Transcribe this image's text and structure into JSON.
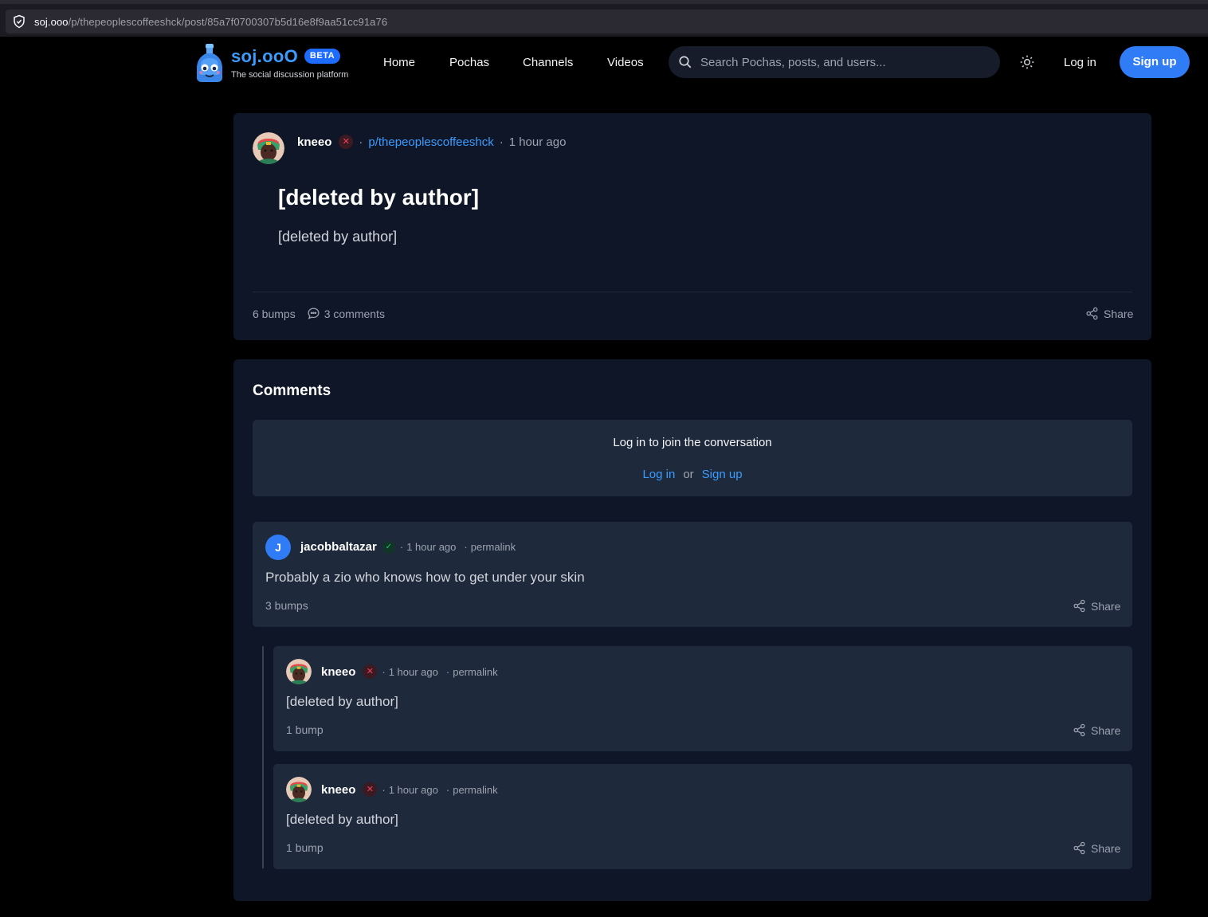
{
  "browser": {
    "url_host": "soj.ooo",
    "url_path": "/p/thepeoplescoffeeshck/post/85a7f0700307b5d16e8f9aa51cc91a76"
  },
  "header": {
    "brand": "soj.ooO",
    "beta": "BETA",
    "tagline": "The social discussion platform",
    "nav": [
      "Home",
      "Pochas",
      "Channels",
      "Videos"
    ],
    "search_placeholder": "Search Pochas, posts, and users...",
    "login": "Log in",
    "signup": "Sign up"
  },
  "post": {
    "author": "kneeo",
    "community": "p/thepeoplescoffeeshck",
    "time": "1 hour ago",
    "title": "[deleted by author]",
    "body": "[deleted by author]",
    "bumps": "6 bumps",
    "comments": "3 comments",
    "share": "Share"
  },
  "comments_section": {
    "title": "Comments",
    "join_text": "Log in to join the conversation",
    "login": "Log in",
    "or": "or",
    "signup": "Sign up",
    "items": [
      {
        "avatar_letter": "J",
        "author": "jacobbaltazar",
        "time": "1 hour ago",
        "permalink": "permalink",
        "body": "Probably a zio who knows how to get under your skin",
        "bumps": "3 bumps",
        "share": "Share"
      },
      {
        "author": "kneeo",
        "time": "1 hour ago",
        "permalink": "permalink",
        "body": "[deleted by author]",
        "bumps": "1 bump",
        "share": "Share"
      },
      {
        "author": "kneeo",
        "time": "1 hour ago",
        "permalink": "permalink",
        "body": "[deleted by author]",
        "bumps": "1 bump",
        "share": "Share"
      }
    ]
  },
  "colors": {
    "accent": "#3b9cff",
    "button": "#2f7cf6",
    "card_bg": "#0f1627",
    "comment_bg": "#1e293b"
  }
}
